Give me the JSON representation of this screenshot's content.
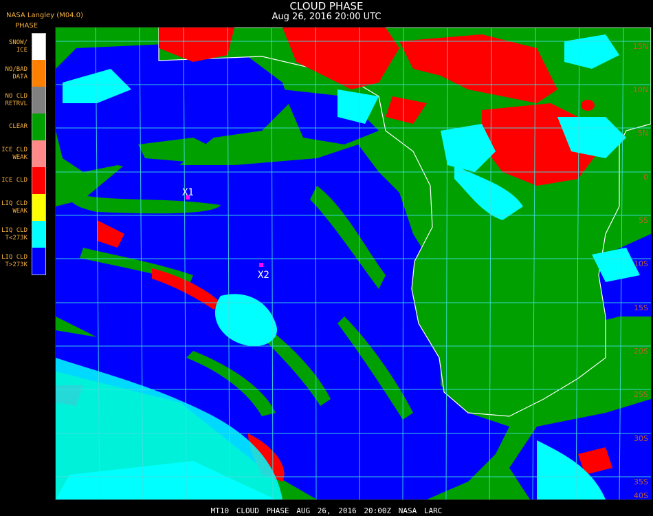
{
  "header": {
    "title": "CLOUD PHASE",
    "subtitle": "Aug 26, 2016 20:00 UTC",
    "producer": "NASA Langley (M04.0)"
  },
  "legend": {
    "title": "PHASE",
    "items": [
      {
        "label": "SNOW/\nICE",
        "color": "#ffffff"
      },
      {
        "label": "NO/BAD\nDATA",
        "color": "#ff8000"
      },
      {
        "label": "NO CLD\nRETRVL",
        "color": "#808080"
      },
      {
        "label": "CLEAR",
        "color": "#00a000"
      },
      {
        "label": "ICE CLD\nWEAK",
        "color": "#ff8888"
      },
      {
        "label": "ICE CLD",
        "color": "#ff0000"
      },
      {
        "label": "LIQ CLD\nWEAK",
        "color": "#ffff00"
      },
      {
        "label": "LIQ CLD\nT<273K",
        "color": "#00ffff"
      },
      {
        "label": "LIQ CLD\nT>273K",
        "color": "#0000ff"
      }
    ]
  },
  "map": {
    "grid_color": "#40e0e0",
    "coast_color": "#ffffff",
    "lat_label_color": "#c0602a",
    "lat_labels": [
      "15N",
      "10N",
      "5N",
      "0",
      "5S",
      "10S",
      "15S",
      "20S",
      "25S",
      "30S",
      "35S",
      "40S"
    ],
    "markers": [
      {
        "label": "X1",
        "color": "#ff00ff"
      },
      {
        "label": "X2",
        "color": "#ff00ff"
      }
    ]
  },
  "footer": "MT10  CLOUD PHASE  AUG 26, 2016 20:00Z  NASA LARC"
}
